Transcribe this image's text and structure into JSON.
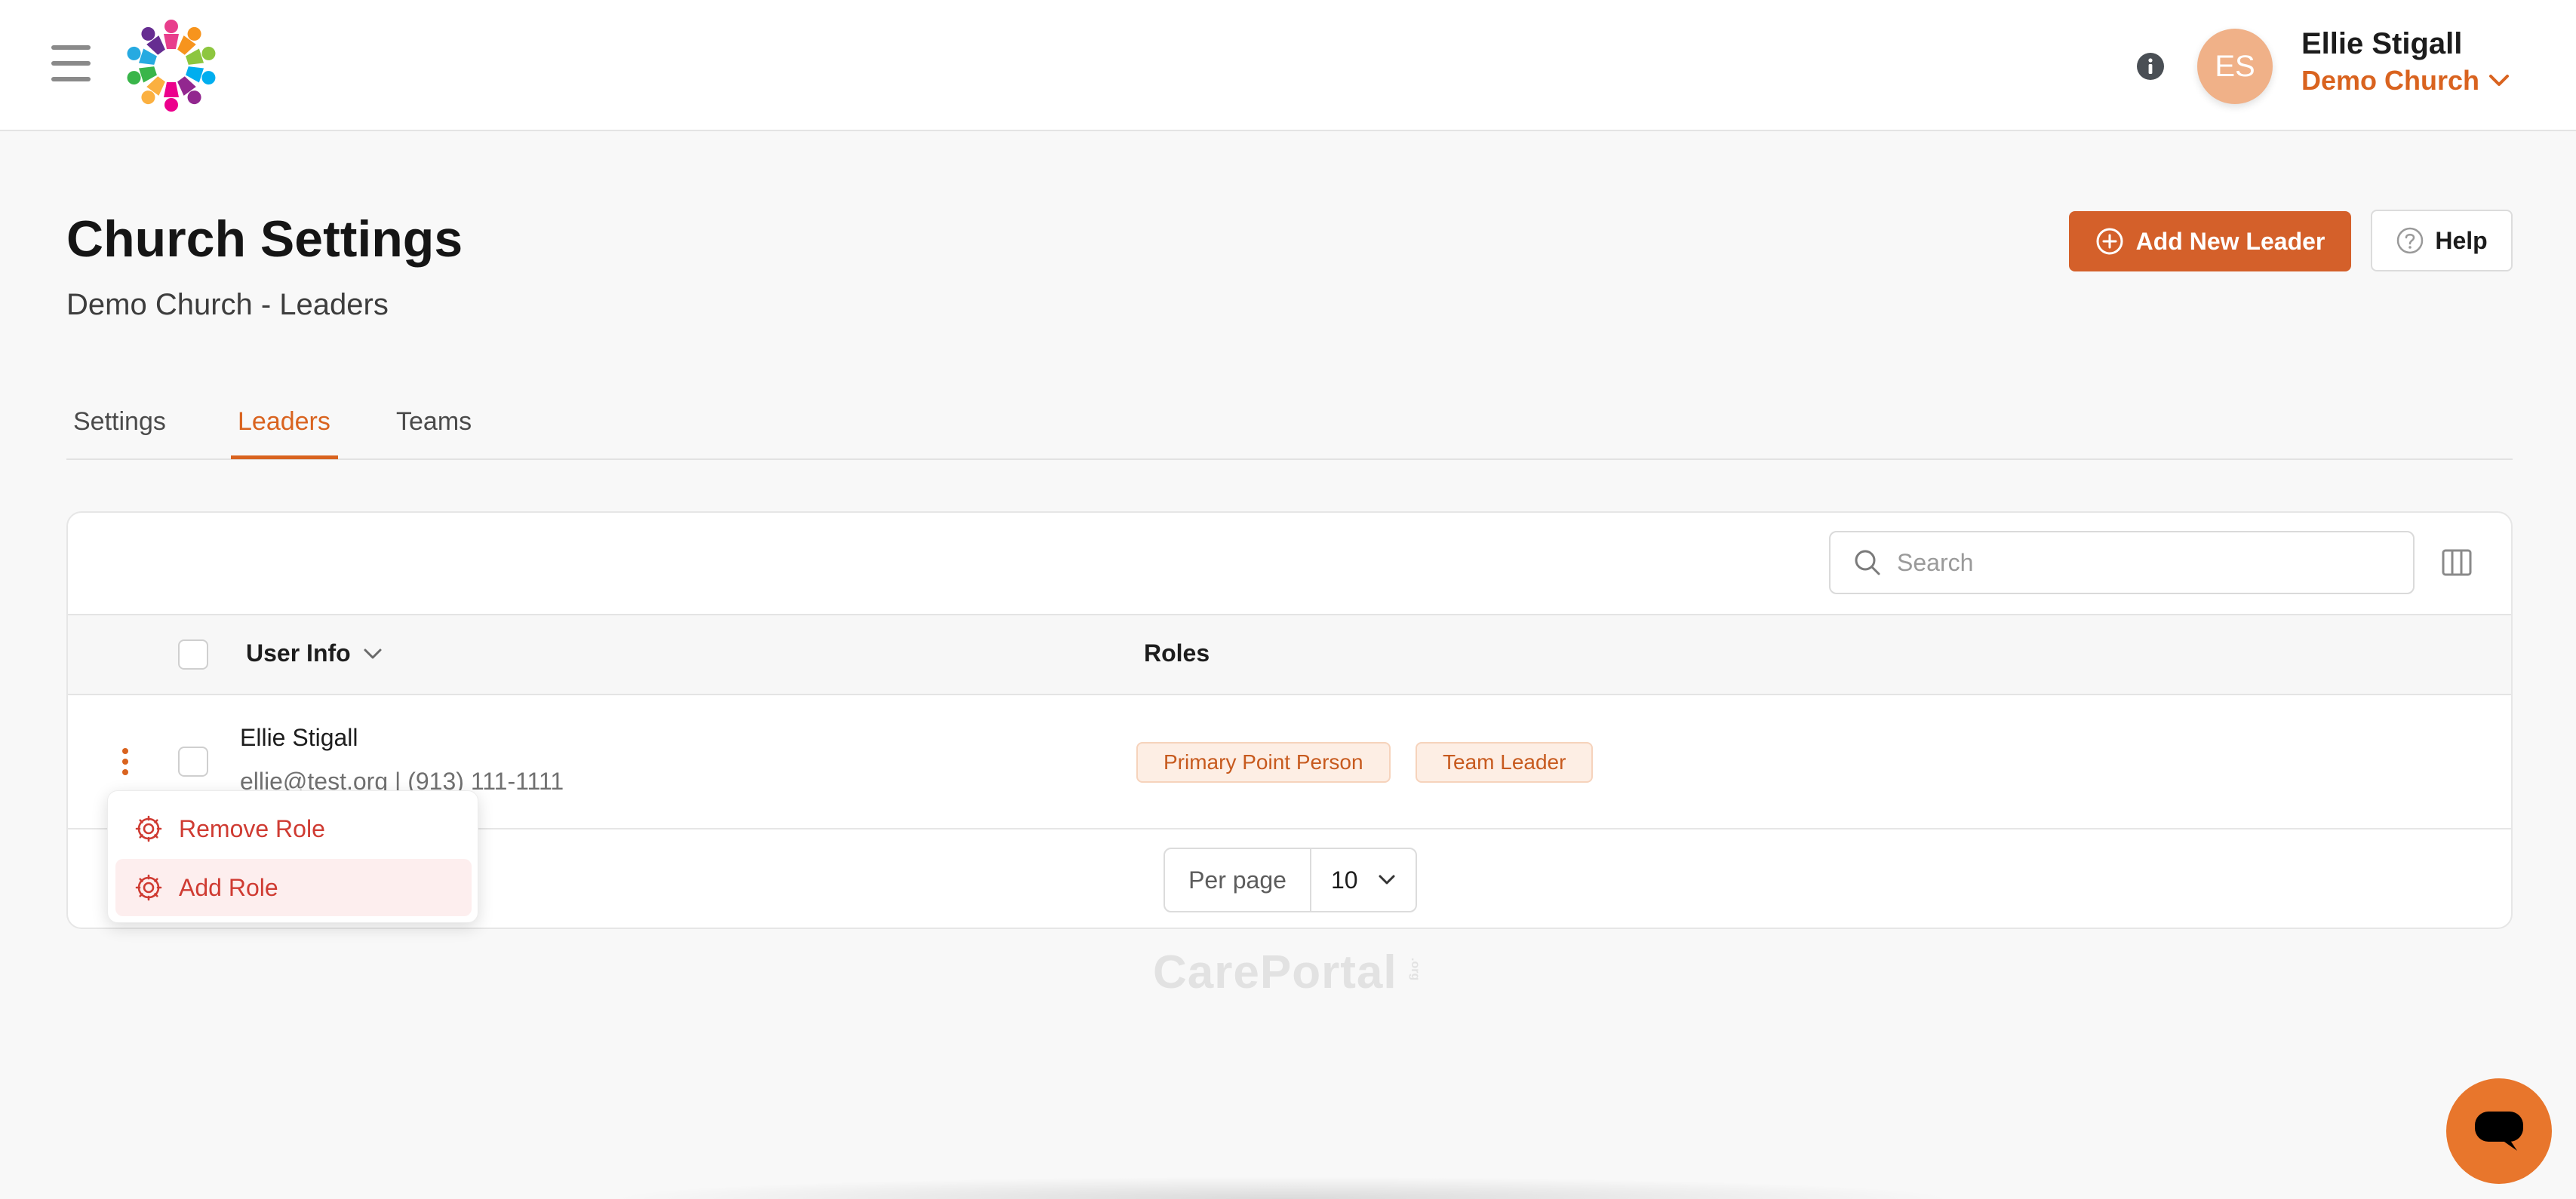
{
  "header": {
    "user_name": "Ellie Stigall",
    "user_initials": "ES",
    "church_name": "Demo Church"
  },
  "page": {
    "title": "Church Settings",
    "subtitle": "Demo Church - Leaders",
    "add_button_label": "Add New Leader",
    "help_button_label": "Help"
  },
  "tabs": [
    {
      "label": "Settings",
      "active": false
    },
    {
      "label": "Leaders",
      "active": true
    },
    {
      "label": "Teams",
      "active": false
    }
  ],
  "table": {
    "search_placeholder": "Search",
    "columns": [
      "User Info",
      "Roles"
    ],
    "rows": [
      {
        "name": "Ellie Stigall",
        "contact": "ellie@test.org | (913) 111-1111",
        "roles": [
          "Primary Point Person",
          "Team Leader"
        ]
      }
    ],
    "per_page_label": "Per page",
    "per_page_value": "10"
  },
  "row_menu": {
    "items": [
      "Remove Role",
      "Add Role"
    ]
  },
  "footer": {
    "watermark": "CarePortal",
    "watermark_suffix": ".org"
  },
  "colors": {
    "accent": "#d9631f",
    "primary_button": "#d4602a",
    "danger_text": "#cf3b32",
    "avatar": "#f0b188"
  },
  "icons": [
    "menu-icon",
    "logo-icon",
    "info-icon",
    "chevron-down-icon",
    "plus-circle-icon",
    "help-circle-icon",
    "search-icon",
    "columns-icon",
    "kebab-icon",
    "gear-icon",
    "chat-icon"
  ]
}
